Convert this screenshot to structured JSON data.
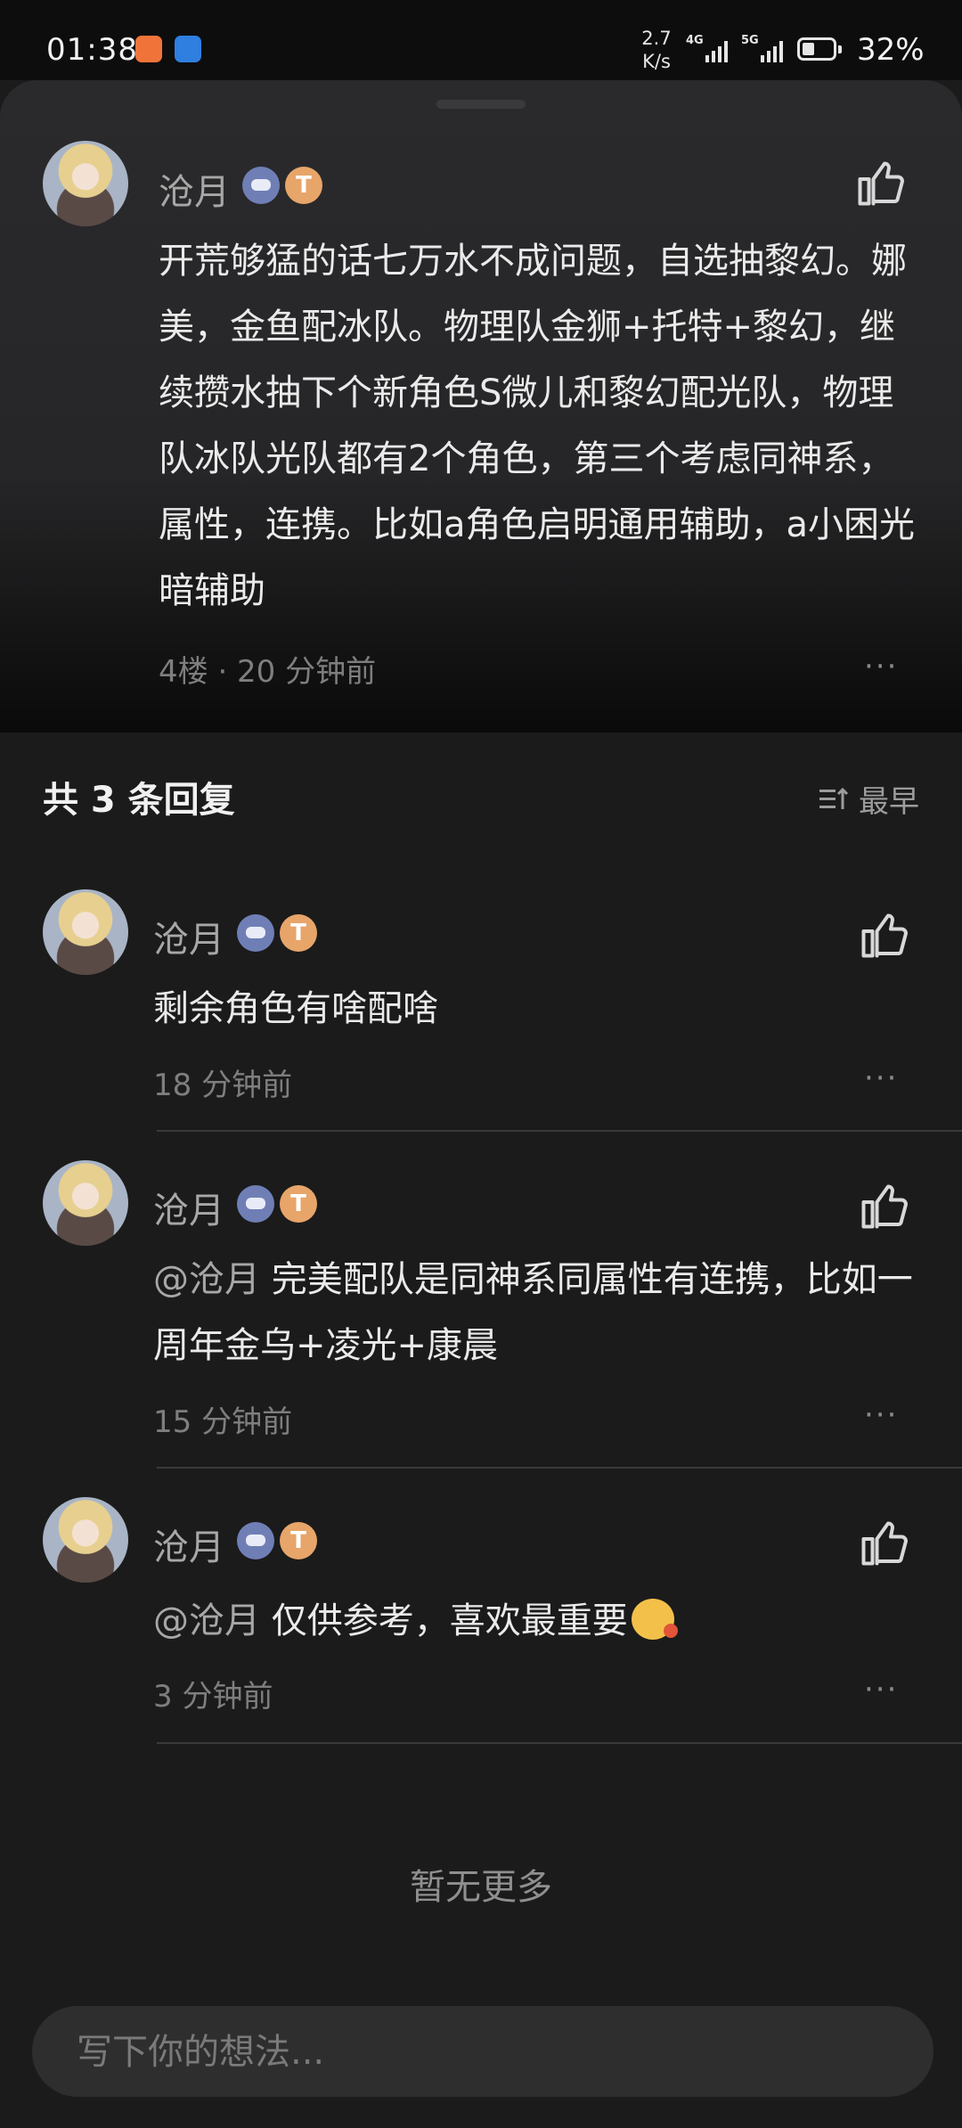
{
  "status_bar": {
    "time": "01:38",
    "net_speed_value": "2.7",
    "net_speed_unit": "K/s",
    "net1": "4G",
    "net2": "5G",
    "battery": "32%",
    "battery_level": 0.32
  },
  "main_comment": {
    "user": "沧月",
    "badge_text": "T",
    "body": "开荒够猛的话七万水不成问题，自选抽黎幻。娜美，金鱼配冰队。物理队金狮+托特+黎幻，继续攒水抽下个新角色S微儿和黎幻配光队，物理队冰队光队都有2个角色，第三个考虑同神系，属性，连携。比如a角色启明通用辅助，a小困光暗辅助",
    "meta": "4楼 · 20 分钟前",
    "more": "···"
  },
  "replies_header": {
    "title": "共 3 条回复",
    "sort_label": "最早"
  },
  "replies": [
    {
      "user": "沧月",
      "badge_text": "T",
      "mention": "",
      "body": "剩余角色有啥配啥",
      "time": "18 分钟前",
      "more": "···"
    },
    {
      "user": "沧月",
      "badge_text": "T",
      "mention": "@沧月",
      "body": "完美配队是同神系同属性有连携，比如一周年金乌+凌光+康晨",
      "time": "15 分钟前",
      "more": "···"
    },
    {
      "user": "沧月",
      "badge_text": "T",
      "mention": "@沧月",
      "body": "仅供参考，喜欢最重要",
      "time": "3 分钟前",
      "more": "···"
    }
  ],
  "footer": {
    "no_more": "暂无更多",
    "input_placeholder": "写下你的想法..."
  },
  "icons": {
    "like": "thumbs-up-icon",
    "sort": "sort-icon",
    "more": "more-dots-icon",
    "emoji": "smiling-emoji-icon"
  },
  "colors": {
    "background": "#1b1b1b",
    "sheet": "#262628",
    "text_primary": "#eaeaea",
    "text_secondary": "#a7a7a7",
    "text_meta": "#7e7e7e",
    "badge_game": "#6f7fb6",
    "badge_level": "#e7a56a"
  }
}
